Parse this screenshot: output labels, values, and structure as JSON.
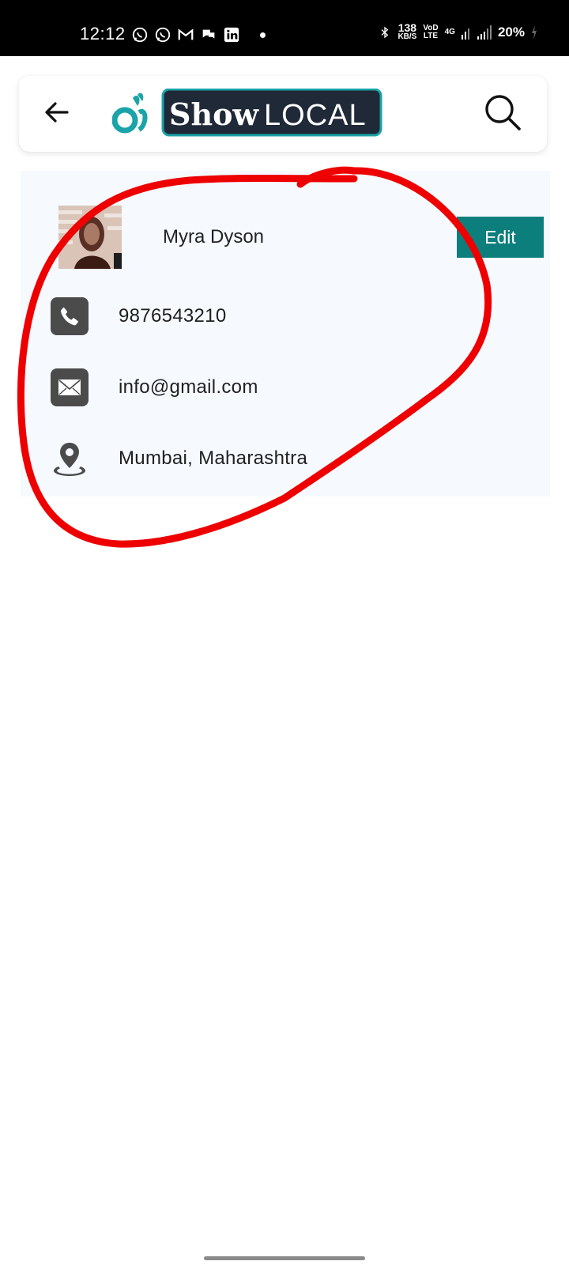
{
  "status_bar": {
    "time": "12:12",
    "notification_icons": [
      "whatsapp-icon",
      "whatsapp-business-icon",
      "gmail-icon",
      "chat-bubbles-icon",
      "linkedin-icon"
    ],
    "net_speed_value": "138",
    "net_speed_unit": "KB/S",
    "volte_top": "VoD",
    "volte_bottom": "LTE",
    "network_type": "4G",
    "battery": "20%"
  },
  "header": {
    "logo_text_show": "Show",
    "logo_text_local": "LOCAL",
    "back_icon": "arrow-left-icon",
    "search_icon": "search-icon"
  },
  "profile": {
    "name": "Myra Dyson",
    "edit_label": "Edit",
    "phone": "9876543210",
    "email": "info@gmail.com",
    "location": "Mumbai, Maharashtra"
  },
  "colors": {
    "accent_teal": "#0c7f7d",
    "logo_teal": "#1aa3a8",
    "logo_dark": "#1f2937",
    "annotation_red": "#ee0000",
    "card_bg": "#f6f9fe"
  }
}
